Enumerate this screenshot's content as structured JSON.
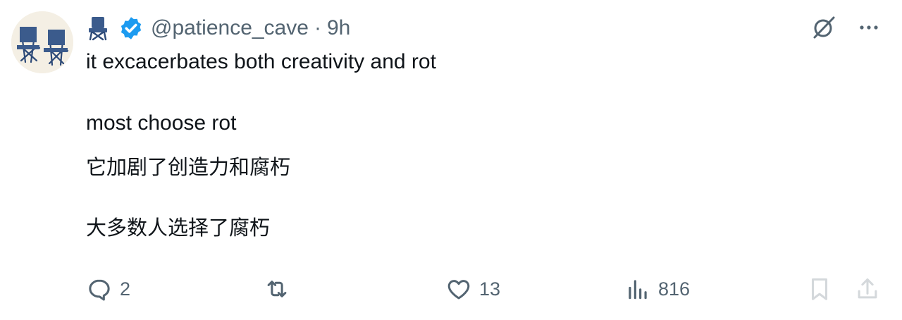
{
  "post": {
    "author_emoji": "chair-icon",
    "handle": "@patience_cave",
    "separator": "·",
    "time": "9h",
    "lines": {
      "line1": "it excacerbates both creativity and rot",
      "line2": "most choose rot",
      "line3": "它加剧了创造力和腐朽",
      "line4": "大多数人选择了腐朽"
    }
  },
  "actions": {
    "replies": "2",
    "reposts": "",
    "likes": "13",
    "views": "816"
  },
  "colors": {
    "text": "#0f1419",
    "muted": "#536471",
    "verified": "#1d9bf0",
    "chair_blue": "#3b5b8c"
  }
}
